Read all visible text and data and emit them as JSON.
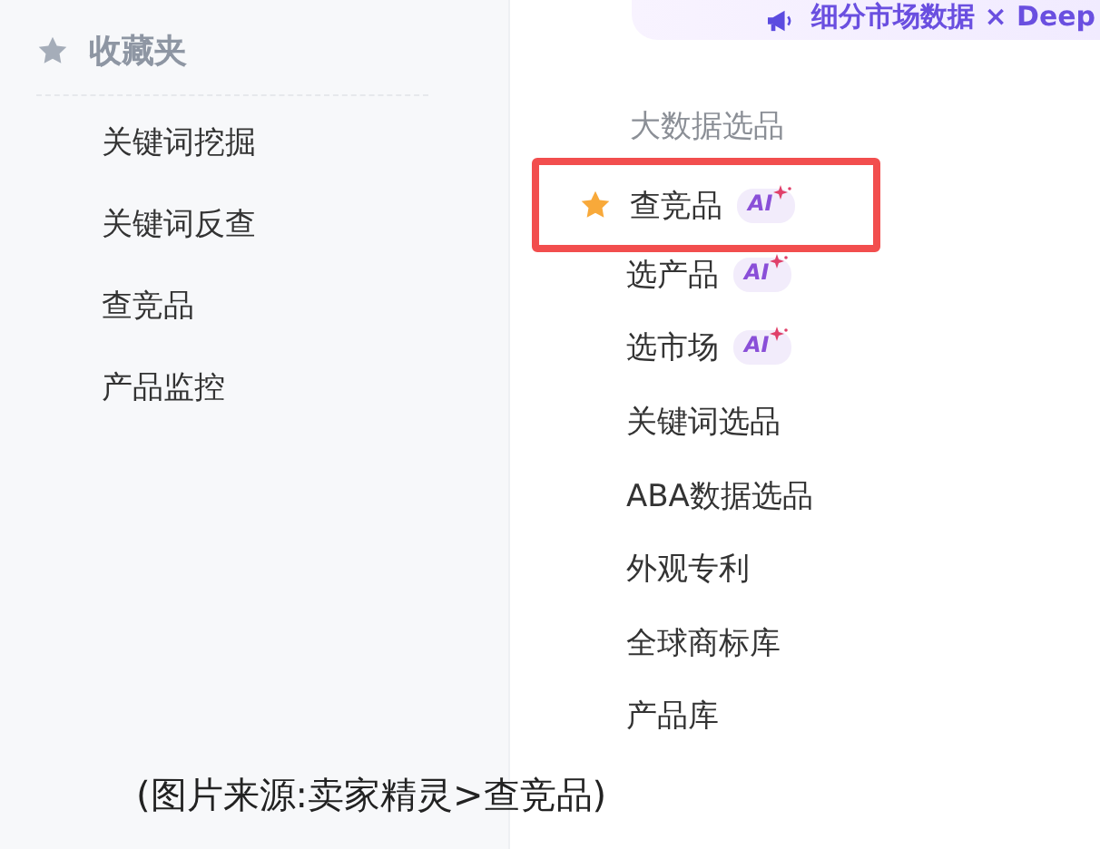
{
  "favorites": {
    "title": "收藏夹",
    "items": [
      {
        "label": "关键词挖掘"
      },
      {
        "label": "关键词反查"
      },
      {
        "label": "查竞品"
      },
      {
        "label": "产品监控"
      }
    ]
  },
  "banner": {
    "text": "细分市场数据 × Deep"
  },
  "menu": {
    "heading": "大数据选品",
    "items": [
      {
        "label": "查竞品",
        "favorited": true,
        "highlighted": true,
        "badge": "AI"
      },
      {
        "label": "选产品",
        "favorited": false,
        "highlighted": false,
        "badge": "AI"
      },
      {
        "label": "选市场",
        "favorited": false,
        "highlighted": false,
        "badge": "AI"
      },
      {
        "label": "关键词选品",
        "favorited": false,
        "highlighted": false
      },
      {
        "label": "ABA数据选品",
        "favorited": false,
        "highlighted": false
      },
      {
        "label": "外观专利",
        "favorited": false,
        "highlighted": false
      },
      {
        "label": "全球商标库",
        "favorited": false,
        "highlighted": false
      },
      {
        "label": "产品库",
        "favorited": false,
        "highlighted": false
      }
    ]
  },
  "caption": "(图片来源:卖家精灵>查竞品)"
}
